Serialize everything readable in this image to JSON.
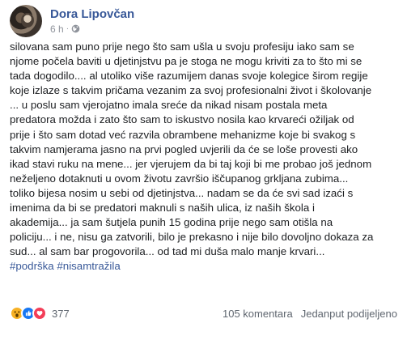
{
  "post": {
    "author": "Dora Lipovčan",
    "time": "6 h",
    "dot": "·",
    "lines": [
      "silovana sam puno prije nego što sam ušla u svoju profesiju iako sam se",
      "njome počela baviti u djetinjstvu pa je stoga ne mogu kriviti za to što mi se",
      "tada dogodilo.... al utoliko više razumijem danas svoje kolegice širom regije",
      "koje izlaze s takvim pričama vezanim za svoj profesionalni život i školovanje",
      "... u poslu sam vjerojatno imala sreće da nikad nisam postala meta",
      "predatora možda i zato što sam to iskustvo nosila kao krvareći ožiljak od",
      "prije i što sam dotad već razvila obrambene mehanizme koje bi svakog s",
      "takvim namjerama jasno na prvi pogled uvjerili da će se loše provesti ako",
      "ikad stavi ruku na mene... jer vjerujem da bi taj koji bi me probao još jednom",
      "neželjeno dotaknuti u ovom životu završio iščupanog grkljana zubima...",
      "toliko bijesa nosim u sebi od djetinjstva... nadam se da će svi sad izaći s",
      "imenima da bi se predatori maknuli s naših ulica, iz naših škola i",
      "akademija... ja sam šutjela punih 15 godina prije nego sam otišla na",
      "policiju... i ne, nisu ga zatvorili, bilo je prekasno i nije bilo dovoljno dokaza za",
      "sud... al sam bar progovorila... od tad mi duša malo manje krvari..."
    ],
    "hashtags": [
      "#podrška",
      "#nisamtražila"
    ]
  },
  "footer": {
    "reaction_count": "377",
    "comments": "105 komentara",
    "shares": "Jedanput podijeljeno"
  },
  "colors": {
    "link": "#385898",
    "text": "#1c1e21",
    "muted": "#606770",
    "like": "#1877f2",
    "love": "#f33e58",
    "wow": "#f7b125"
  },
  "icons": [
    "avatar",
    "globe-icon",
    "wow-reaction-icon",
    "like-reaction-icon",
    "love-reaction-icon"
  ]
}
